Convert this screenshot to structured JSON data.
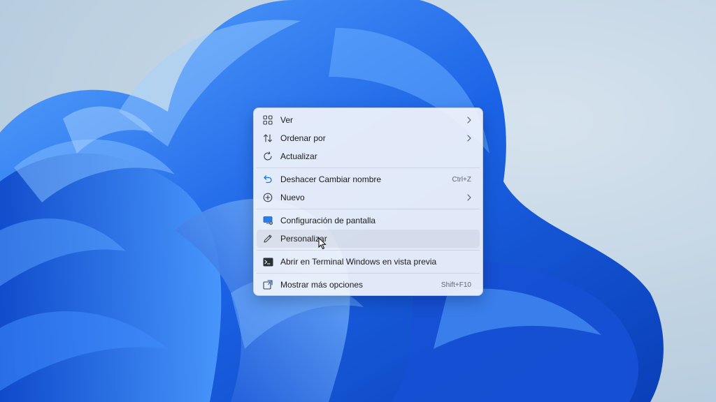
{
  "menu": {
    "groups": [
      [
        {
          "label": "Ver",
          "icon": "grid-view-icon",
          "submenu": true
        },
        {
          "label": "Ordenar por",
          "icon": "sort-arrows-icon",
          "submenu": true
        },
        {
          "label": "Actualizar",
          "icon": "refresh-icon"
        }
      ],
      [
        {
          "label": "Deshacer Cambiar nombre",
          "icon": "undo-icon",
          "shortcut": "Ctrl+Z"
        },
        {
          "label": "Nuevo",
          "icon": "plus-circle-icon",
          "submenu": true
        }
      ],
      [
        {
          "label": "Configuración de pantalla",
          "icon": "display-settings-icon"
        },
        {
          "label": "Personalizar",
          "icon": "pencil-icon",
          "highlighted": true
        }
      ],
      [
        {
          "label": "Abrir en Terminal Windows en vista previa",
          "icon": "terminal-icon"
        }
      ],
      [
        {
          "label": "Mostrar más opciones",
          "icon": "more-options-icon",
          "shortcut": "Shift+F10"
        }
      ]
    ]
  },
  "colors": {
    "accent": "#0067c0",
    "wallpaper_blue": "#1f6fe0"
  }
}
